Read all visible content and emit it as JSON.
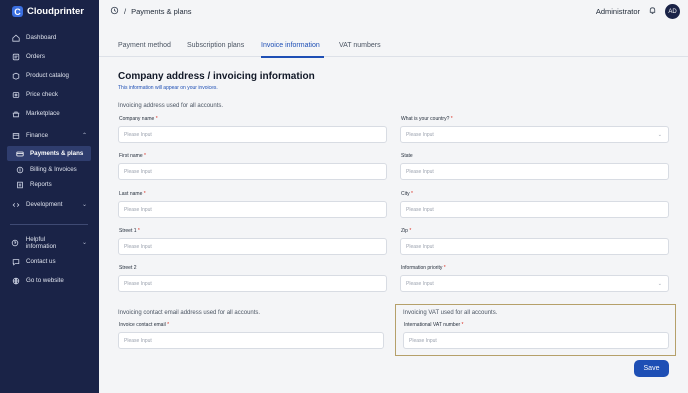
{
  "app": {
    "name": "Cloudprinter"
  },
  "sidebar": {
    "items": [
      {
        "label": "Dashboard",
        "icon": "home-icon"
      },
      {
        "label": "Orders",
        "icon": "orders-icon"
      },
      {
        "label": "Product catalog",
        "icon": "catalog-icon"
      },
      {
        "label": "Price check",
        "icon": "price-icon"
      },
      {
        "label": "Marketplace",
        "icon": "marketplace-icon"
      },
      {
        "label": "Finance",
        "icon": "finance-icon"
      },
      {
        "label": "Payments & plans",
        "icon": "payments-icon"
      },
      {
        "label": "Billing & Invoices",
        "icon": "billing-icon"
      },
      {
        "label": "Reports",
        "icon": "reports-icon"
      },
      {
        "label": "Development",
        "icon": "code-icon"
      },
      {
        "label": "Helpful information",
        "icon": "help-icon"
      },
      {
        "label": "Contact us",
        "icon": "chat-icon"
      },
      {
        "label": "Go to website",
        "icon": "globe-icon"
      }
    ]
  },
  "header": {
    "breadcrumb_sep": "/",
    "breadcrumb": "Payments & plans",
    "user_name": "Administrator",
    "avatar_initials": "AD"
  },
  "tabs": [
    "Payment method",
    "Subscription plans",
    "Invoice information",
    "VAT numbers"
  ],
  "form": {
    "title": "Company address / invoicing information",
    "subtitle": "This information will appear on your invoices.",
    "section_address": "Invoicing address used for all accounts.",
    "section_email": "Invoicing contact email address used for all accounts.",
    "section_vat": "Invoicing VAT used for all accounts.",
    "required_mark": "*",
    "placeholder": "Please Input",
    "fields": {
      "company_name": "Company name",
      "country": "What is your country?",
      "first_name": "First name",
      "state": "State",
      "last_name": "Last name",
      "city": "City",
      "street1": "Street 1",
      "zip": "Zip",
      "street2": "Street 2",
      "info_priority": "Information priority",
      "contact_email": "Invoice contact email",
      "vat_number": "International VAT number"
    },
    "save_label": "Save"
  },
  "colors": {
    "sidebar_bg": "#1a2347",
    "accent": "#1e4fb5",
    "required": "#d92d20",
    "highlight_border": "#b5a06a"
  }
}
